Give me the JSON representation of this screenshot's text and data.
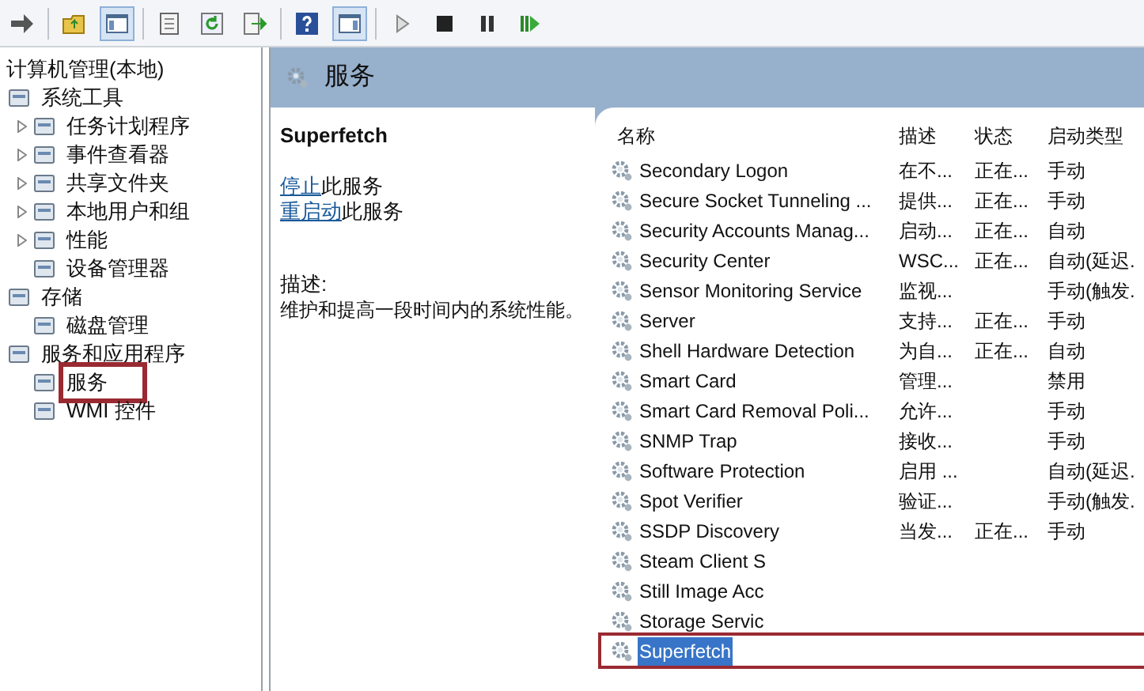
{
  "toolbar": {
    "buttons": [
      {
        "kind": "back"
      },
      {
        "kind": "up"
      },
      {
        "kind": "tree",
        "selected": true
      },
      {
        "kind": "properties"
      },
      {
        "kind": "refresh"
      },
      {
        "kind": "export"
      },
      {
        "kind": "help"
      },
      {
        "kind": "action",
        "selected": true
      },
      {
        "kind": "play"
      },
      {
        "kind": "stop"
      },
      {
        "kind": "pause"
      },
      {
        "kind": "resume"
      }
    ]
  },
  "tree": {
    "label": "计算机管理(本地)",
    "children": [
      {
        "label": "系统工具",
        "marked": false,
        "children": [
          {
            "label": "任务计划程序",
            "expandable": true,
            "marked": false
          },
          {
            "label": "事件查看器",
            "expandable": true,
            "marked": false
          },
          {
            "label": "共享文件夹",
            "expandable": true,
            "marked": false
          },
          {
            "label": "本地用户和组",
            "expandable": true,
            "marked": false
          },
          {
            "label": "性能",
            "expandable": true,
            "marked": false
          },
          {
            "label": "设备管理器",
            "expandable": false,
            "marked": false
          }
        ]
      },
      {
        "label": "存储",
        "marked": false,
        "children": [
          {
            "label": "磁盘管理",
            "expandable": false,
            "marked": false
          }
        ]
      },
      {
        "label": "服务和应用程序",
        "marked": false,
        "children": [
          {
            "label": "服务",
            "expandable": false,
            "marked": true
          },
          {
            "label": "WMI 控件",
            "expandable": false,
            "marked": false
          }
        ]
      }
    ]
  },
  "header": {
    "title": "服务"
  },
  "details": {
    "name": "Superfetch",
    "links": [
      {
        "link": "停止",
        "rest": "此服务"
      },
      {
        "link": "重启动",
        "rest": "此服务"
      }
    ],
    "description_label": "描述:",
    "description": "维护和提高一段时间内的系统性能。"
  },
  "table": {
    "columns": [
      "名称",
      "描述",
      "状态",
      "启动类型"
    ],
    "rows": [
      {
        "name": "Secondary Logon",
        "desc": "在不...",
        "status": "正在...",
        "startup": "手动",
        "selected": false,
        "marked": false
      },
      {
        "name": "Secure Socket Tunneling ...",
        "desc": "提供...",
        "status": "正在...",
        "startup": "手动",
        "selected": false,
        "marked": false
      },
      {
        "name": "Security Accounts Manag...",
        "desc": "启动...",
        "status": "正在...",
        "startup": "自动",
        "selected": false,
        "marked": false
      },
      {
        "name": "Security Center",
        "desc": "WSC...",
        "status": "正在...",
        "startup": "自动(延迟.",
        "selected": false,
        "marked": false
      },
      {
        "name": "Sensor Monitoring Service",
        "desc": "监视...",
        "startup": "手动(触发.",
        "selected": false,
        "marked": false
      },
      {
        "name": "Server",
        "desc": "支持...",
        "status": "正在...",
        "startup": "手动",
        "selected": false,
        "marked": false
      },
      {
        "name": "Shell Hardware Detection",
        "desc": "为自...",
        "status": "正在...",
        "startup": "自动",
        "selected": false,
        "marked": false
      },
      {
        "name": "Smart Card",
        "desc": "管理...",
        "startup": "禁用",
        "selected": false,
        "marked": false
      },
      {
        "name": "Smart Card Removal Poli...",
        "desc": "允许...",
        "startup": "手动",
        "selected": false,
        "marked": false
      },
      {
        "name": "SNMP Trap",
        "desc": "接收...",
        "startup": "手动",
        "selected": false,
        "marked": false
      },
      {
        "name": "Software Protection",
        "desc": "启用 ...",
        "startup": "自动(延迟.",
        "selected": false,
        "marked": false
      },
      {
        "name": "Spot Verifier",
        "desc": "验证...",
        "startup": "手动(触发.",
        "selected": false,
        "marked": false
      },
      {
        "name": "SSDP Discovery",
        "desc": "当发...",
        "status": "正在...",
        "startup": "手动",
        "selected": false,
        "marked": false
      },
      {
        "name": "Steam Client S",
        "selected": false,
        "marked": false
      },
      {
        "name": "Still Image Acc",
        "selected": false,
        "marked": false
      },
      {
        "name": "Storage Servic",
        "selected": false,
        "marked": false
      },
      {
        "name": "Superfetch",
        "selected": true,
        "marked": true
      }
    ]
  }
}
